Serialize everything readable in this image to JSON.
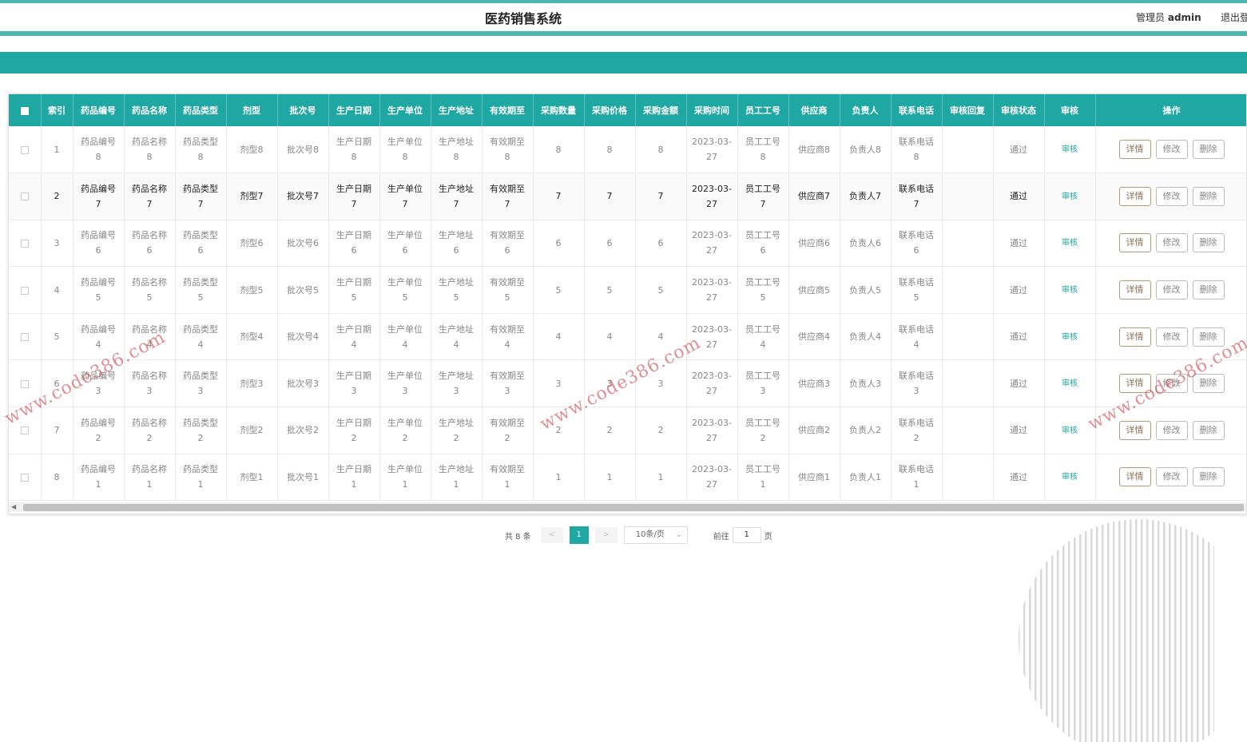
{
  "header": {
    "title": "医药销售系统",
    "user_role": "管理员",
    "user_name": "admin",
    "logout": "退出登"
  },
  "table": {
    "columns": [
      "索引",
      "药品编号",
      "药品名称",
      "药品类型",
      "剂型",
      "批次号",
      "生产日期",
      "生产单位",
      "生产地址",
      "有效期至",
      "采购数量",
      "采购价格",
      "采购金额",
      "采购时间",
      "员工工号",
      "供应商",
      "负责人",
      "联系电话",
      "审核回复",
      "审核状态",
      "审核",
      "操作"
    ],
    "rows": [
      {
        "index": "1",
        "code": "药品编号8",
        "name": "药品名称8",
        "type": "药品类型8",
        "form": "剂型8",
        "batch": "批次号8",
        "mfg_date": "生产日期8",
        "mfg_unit": "生产单位8",
        "mfg_addr": "生产地址8",
        "expiry": "有效期至8",
        "qty": "8",
        "price": "8",
        "amount": "8",
        "purchase_time": "2023-03-27",
        "emp_no": "员工工号8",
        "supplier": "供应商8",
        "owner": "负责人8",
        "phone": "联系电话8",
        "reply": "",
        "status": "通过"
      },
      {
        "index": "2",
        "code": "药品编号7",
        "name": "药品名称7",
        "type": "药品类型7",
        "form": "剂型7",
        "batch": "批次号7",
        "mfg_date": "生产日期7",
        "mfg_unit": "生产单位7",
        "mfg_addr": "生产地址7",
        "expiry": "有效期至7",
        "qty": "7",
        "price": "7",
        "amount": "7",
        "purchase_time": "2023-03-27",
        "emp_no": "员工工号7",
        "supplier": "供应商7",
        "owner": "负责人7",
        "phone": "联系电话7",
        "reply": "",
        "status": "通过"
      },
      {
        "index": "3",
        "code": "药品编号6",
        "name": "药品名称6",
        "type": "药品类型6",
        "form": "剂型6",
        "batch": "批次号6",
        "mfg_date": "生产日期6",
        "mfg_unit": "生产单位6",
        "mfg_addr": "生产地址6",
        "expiry": "有效期至6",
        "qty": "6",
        "price": "6",
        "amount": "6",
        "purchase_time": "2023-03-27",
        "emp_no": "员工工号6",
        "supplier": "供应商6",
        "owner": "负责人6",
        "phone": "联系电话6",
        "reply": "",
        "status": "通过"
      },
      {
        "index": "4",
        "code": "药品编号5",
        "name": "药品名称5",
        "type": "药品类型5",
        "form": "剂型5",
        "batch": "批次号5",
        "mfg_date": "生产日期5",
        "mfg_unit": "生产单位5",
        "mfg_addr": "生产地址5",
        "expiry": "有效期至5",
        "qty": "5",
        "price": "5",
        "amount": "5",
        "purchase_time": "2023-03-27",
        "emp_no": "员工工号5",
        "supplier": "供应商5",
        "owner": "负责人5",
        "phone": "联系电话5",
        "reply": "",
        "status": "通过"
      },
      {
        "index": "5",
        "code": "药品编号4",
        "name": "药品名称4",
        "type": "药品类型4",
        "form": "剂型4",
        "batch": "批次号4",
        "mfg_date": "生产日期4",
        "mfg_unit": "生产单位4",
        "mfg_addr": "生产地址4",
        "expiry": "有效期至4",
        "qty": "4",
        "price": "4",
        "amount": "4",
        "purchase_time": "2023-03-27",
        "emp_no": "员工工号4",
        "supplier": "供应商4",
        "owner": "负责人4",
        "phone": "联系电话4",
        "reply": "",
        "status": "通过"
      },
      {
        "index": "6",
        "code": "药品编号3",
        "name": "药品名称3",
        "type": "药品类型3",
        "form": "剂型3",
        "batch": "批次号3",
        "mfg_date": "生产日期3",
        "mfg_unit": "生产单位3",
        "mfg_addr": "生产地址3",
        "expiry": "有效期至3",
        "qty": "3",
        "price": "3",
        "amount": "3",
        "purchase_time": "2023-03-27",
        "emp_no": "员工工号3",
        "supplier": "供应商3",
        "owner": "负责人3",
        "phone": "联系电话3",
        "reply": "",
        "status": "通过"
      },
      {
        "index": "7",
        "code": "药品编号2",
        "name": "药品名称2",
        "type": "药品类型2",
        "form": "剂型2",
        "batch": "批次号2",
        "mfg_date": "生产日期2",
        "mfg_unit": "生产单位2",
        "mfg_addr": "生产地址2",
        "expiry": "有效期至2",
        "qty": "2",
        "price": "2",
        "amount": "2",
        "purchase_time": "2023-03-27",
        "emp_no": "员工工号2",
        "supplier": "供应商2",
        "owner": "负责人2",
        "phone": "联系电话2",
        "reply": "",
        "status": "通过"
      },
      {
        "index": "8",
        "code": "药品编号1",
        "name": "药品名称1",
        "type": "药品类型1",
        "form": "剂型1",
        "batch": "批次号1",
        "mfg_date": "生产日期1",
        "mfg_unit": "生产单位1",
        "mfg_addr": "生产地址1",
        "expiry": "有效期至1",
        "qty": "1",
        "price": "1",
        "amount": "1",
        "purchase_time": "2023-03-27",
        "emp_no": "员工工号1",
        "supplier": "供应商1",
        "owner": "负责人1",
        "phone": "联系电话1",
        "reply": "",
        "status": "通过"
      }
    ],
    "audit_label": "审核",
    "actions": {
      "detail": "详情",
      "edit": "修改",
      "delete": "删除"
    }
  },
  "pagination": {
    "total": "共 8 条",
    "prev": "<",
    "current": "1",
    "next": ">",
    "page_size": "10条/页",
    "goto_label": "前往",
    "goto_value": "1",
    "page_suffix": "页"
  },
  "watermark": "www.code386.com",
  "colors": {
    "primary": "#1ea7a3",
    "header_line": "#4db6ac"
  }
}
